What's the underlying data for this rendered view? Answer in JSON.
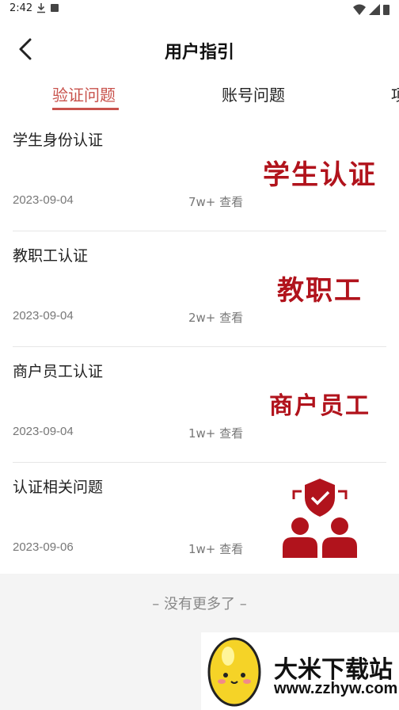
{
  "status": {
    "time": "2:42"
  },
  "header": {
    "title": "用户指引"
  },
  "tabs": [
    {
      "label": "验证问题",
      "active": true
    },
    {
      "label": "账号问题",
      "active": false
    },
    {
      "label": "项",
      "active": false
    }
  ],
  "items": [
    {
      "title": "学生身份认证",
      "date": "2023-09-04",
      "views": "7w+ 查看",
      "thumb_text": "学生认证",
      "thumb_icon": "text-banner"
    },
    {
      "title": "教职工认证",
      "date": "2023-09-04",
      "views": "2w+ 查看",
      "thumb_text": "教职工",
      "thumb_icon": "text-banner"
    },
    {
      "title": "商户员工认证",
      "date": "2023-09-04",
      "views": "1w+ 查看",
      "thumb_text": "商户员工",
      "thumb_icon": "text-banner"
    },
    {
      "title": "认证相关问题",
      "date": "2023-09-06",
      "views": "1w+ 查看",
      "thumb_text": "",
      "thumb_icon": "users-shield-icon"
    }
  ],
  "footer": {
    "no_more": "– 没有更多了 –"
  },
  "watermark": {
    "text": "大米下载站",
    "url": "www.zzhyw.com"
  },
  "colors": {
    "accent": "#c8524c",
    "thumb_red": "#b1131c"
  }
}
